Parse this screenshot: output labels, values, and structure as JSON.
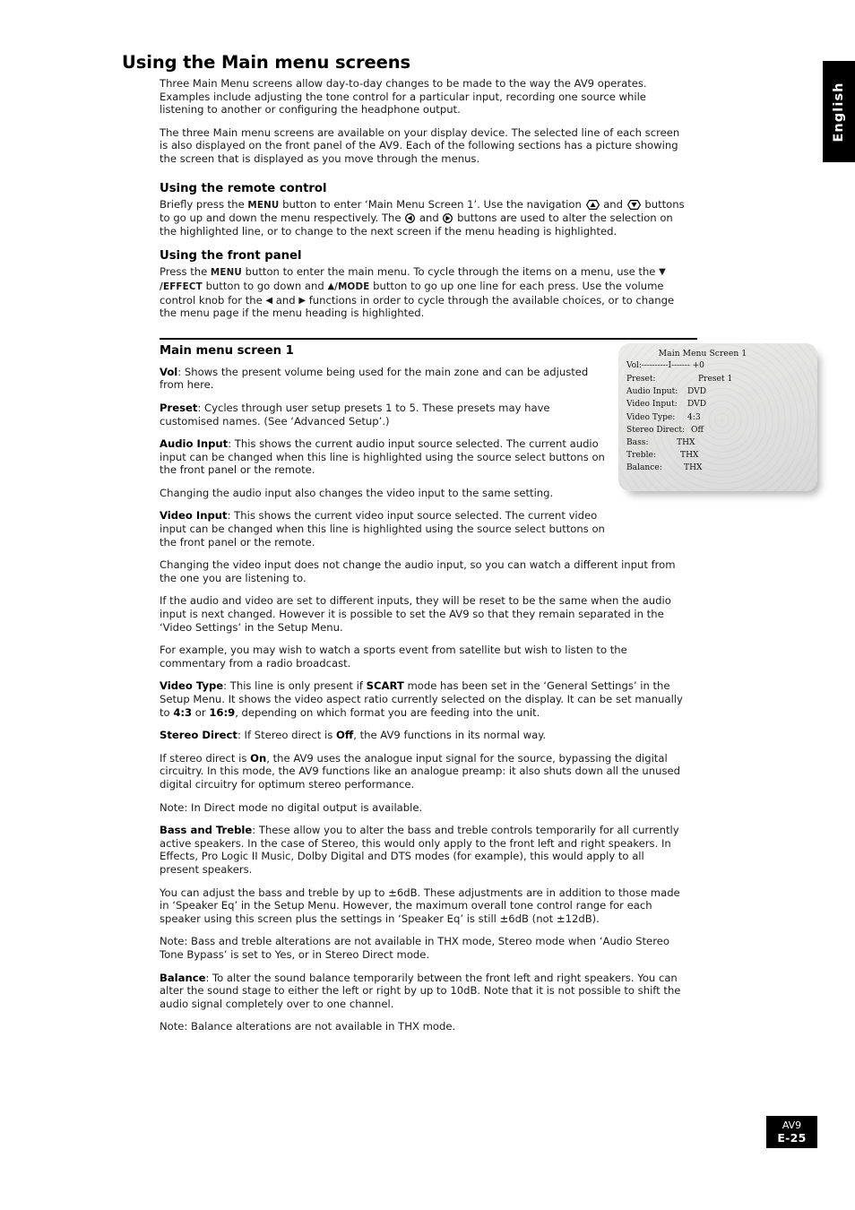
{
  "language_tab": {
    "label": "English"
  },
  "heading": "Using the Main menu screens",
  "intro_paragraphs": [
    "Three Main Menu screens allow day-to-day changes to be made to the way the AV9 operates. Examples include adjusting the tone control for a particular input, recording one source while listening to another or configuring the headphone output.",
    "The three Main menu screens are available on your display device. The selected line of each screen is also displayed on the front panel of the AV9. Each of the following sections has a picture showing the screen that is displayed as you move through the menus."
  ],
  "remote_section": {
    "heading": "Using the remote control",
    "text_1": "Briefly press the ",
    "menu_key": "MENU",
    "text_2": " button to enter ‘Main Menu Screen 1’. Use the navigation ",
    "icon_up": "nav-up-icon",
    "text_3": " and ",
    "icon_down": "nav-down-icon",
    "text_4": " buttons to go up and down the menu respectively. The ",
    "icon_left": "nav-left-icon",
    "text_5": " and ",
    "icon_right": "nav-right-icon",
    "text_6": " buttons are used to alter the selection on the highlighted line, or to change to the next screen if the menu heading is highlighted."
  },
  "front_panel_section": {
    "heading": "Using the front panel",
    "text_1": "Press the ",
    "menu_key": "MENU",
    "text_2": " button to enter the main menu. To cycle through the items on a menu, use the ",
    "down_triangle": "▼",
    "effect_key": "/EFFECT",
    "text_3": " button to go down and ",
    "up_triangle": "▲",
    "mode_key": "/MODE",
    "text_4": " button to go up one line for each press. Use the volume control knob for the ",
    "left_triangle": "◀",
    "text_5": " and ",
    "right_triangle": "▶",
    "text_6": " functions in order to cycle through the available choices, or to change the menu page if the menu heading is highlighted."
  },
  "main_menu_section": {
    "heading": "Main menu screen 1",
    "entries": [
      {
        "term": "Vol",
        "rest": ": Shows the present volume being used for the main zone and can be adjusted from here.",
        "narrow": true
      },
      {
        "term": "Preset",
        "rest": ": Cycles through user setup presets 1 to 5. These presets may have customised names. (See ‘Advanced Setup’.)",
        "narrow": true
      },
      {
        "term": "Audio Input",
        "rest": ": This shows the current audio input source selected. The current audio input can be changed when this line is highlighted using the source select buttons on the front panel or the remote.",
        "narrow": true
      },
      {
        "term": "",
        "rest": "Changing the audio input also changes the video input to the same setting.",
        "narrow": true
      },
      {
        "term": "Video Input",
        "rest": ": This shows the current video input source selected. The current video input can be changed when this line is highlighted using the source select buttons on the front panel or the remote.",
        "narrow": true
      },
      {
        "term": "",
        "rest": "Changing the video input does not change the audio input, so you can watch a different input from the one you are listening to.",
        "narrow": false
      },
      {
        "term": "",
        "rest": "If the audio and video are set to different inputs, they will be reset to be the same when the audio input is next changed. However it is possible to set the AV9 so that they remain separated in the ‘Video Settings’ in the Setup Menu.",
        "narrow": false
      },
      {
        "term": "",
        "rest": "For example, you may wish to watch a sports event from satellite but wish to listen to the commentary from a radio broadcast.",
        "narrow": false
      }
    ],
    "video_type": {
      "term": "Video Type",
      "part_1": ": This line is only present if ",
      "bold_1": "SCART",
      "part_2": " mode has been set in the ‘General Settings’ in the Setup Menu. It shows the video aspect ratio currently selected on the display. It can be set manually to ",
      "bold_2": "4:3",
      "part_3": " or ",
      "bold_3": "16:9",
      "part_4": ", depending on which format you are feeding into the unit."
    },
    "stereo_direct": {
      "term": "Stereo Direct",
      "part_1": ": If Stereo direct is ",
      "bold_1": "Off",
      "part_2": ", the AV9 functions in its normal way."
    },
    "stereo_direct_on": {
      "part_1": "If stereo direct is ",
      "bold_1": "On",
      "part_2": ", the AV9 uses the analogue input signal for the source, bypassing the digital circuitry. In this mode, the AV9 functions like an analogue preamp: it also shuts down all the unused digital circuitry for optimum stereo performance."
    },
    "note_direct": "Note: In Direct mode no digital output is available.",
    "bass_treble": {
      "term": "Bass and Treble",
      "rest": ": These allow you to alter the bass and treble controls temporarily for all currently active speakers. In the case of Stereo, this would only apply to the front left and right speakers. In Effects, Pro Logic II Music, Dolby Digital and DTS modes (for example), this would apply to all present speakers."
    },
    "bass_treble_range": "You can adjust the bass and treble by up to ±6dB. These adjustments are in addition to those made in ‘Speaker Eq’ in the Setup Menu. However, the maximum overall tone control range for each speaker using this screen plus the settings in ‘Speaker Eq’ is still ±6dB (not ±12dB).",
    "note_bass_treble": "Note: Bass and treble alterations are not available in THX mode, Stereo mode when ‘Audio Stereo Tone Bypass’ is set to Yes, or in Stereo Direct mode.",
    "balance": {
      "term": "Balance",
      "rest": ": To alter the sound balance temporarily between the front left and right speakers. You can alter the sound stage to either the left or right by up to 10dB. Note that it is not possible to shift the audio signal completely over to one channel."
    },
    "note_balance": "Note: Balance alterations are not available in THX mode."
  },
  "menu_screenshot": {
    "title": "Main Menu Screen 1",
    "volume_line": "Vol:----------I-------  +0",
    "rows": [
      {
        "label": "Preset:",
        "value": "Preset 1"
      },
      {
        "label": "Audio Input:",
        "value": "DVD"
      },
      {
        "label": "Video Input:",
        "value": "DVD"
      },
      {
        "label": "Video Type:",
        "value": "4:3"
      },
      {
        "label": "Stereo Direct:",
        "value": "Off"
      },
      {
        "label": "Bass:",
        "value": "THX"
      },
      {
        "label": "Treble:",
        "value": "THX"
      },
      {
        "label": "Balance:",
        "value": "THX"
      }
    ]
  },
  "footer": {
    "model": "AV9",
    "page": "E-25"
  }
}
